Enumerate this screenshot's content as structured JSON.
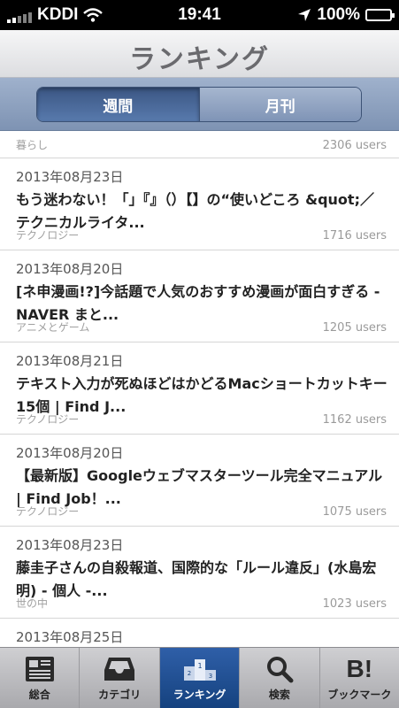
{
  "status_bar": {
    "carrier": "KDDI",
    "time": "19:41",
    "battery": "100%"
  },
  "nav": {
    "title": "ランキング"
  },
  "segments": {
    "items": [
      {
        "label": "週間",
        "selected": true
      },
      {
        "label": "月刊",
        "selected": false
      }
    ]
  },
  "list": {
    "partial": {
      "category": "暮らし",
      "users": "2306 users"
    },
    "items": [
      {
        "date": "2013年08月23日",
        "title": "もう迷わない！「」『』（）【】の“使いどころ &quot;／テクニカルライタ...",
        "category": "テクノロジー",
        "users": "1716 users"
      },
      {
        "date": "2013年08月20日",
        "title": "[ネ申漫画!?]今話題で人気のおすすめ漫画が面白すぎる - NAVER まと...",
        "category": "アニメとゲーム",
        "users": "1205 users"
      },
      {
        "date": "2013年08月21日",
        "title": "テキスト入力が死ぬほどはかどるMacショートカットキー15個 | Find J...",
        "category": "テクノロジー",
        "users": "1162 users"
      },
      {
        "date": "2013年08月20日",
        "title": "【最新版】Googleウェブマスターツール完全マニュアル | Find Job！...",
        "category": "テクノロジー",
        "users": "1075 users"
      },
      {
        "date": "2013年08月23日",
        "title": "藤圭子さんの自殺報道、国際的な「ルール違反」(水島宏明) - 個人 -...",
        "category": "世の中",
        "users": "1023 users"
      },
      {
        "date": "2013年08月25日",
        "title": "",
        "category": "",
        "users": ""
      }
    ]
  },
  "tabbar": {
    "tabs": [
      {
        "label": "総合",
        "icon": "newspaper-icon"
      },
      {
        "label": "カテゴリ",
        "icon": "inbox-tray-icon"
      },
      {
        "label": "ランキング",
        "icon": "podium-icon",
        "active": true
      },
      {
        "label": "検索",
        "icon": "search-icon"
      },
      {
        "label": "ブックマーク",
        "icon": "hatena-bookmark-icon",
        "glyph": "B!"
      }
    ]
  },
  "colors": {
    "accent": "#2f5fa8",
    "segment_active": "#3b5683"
  }
}
